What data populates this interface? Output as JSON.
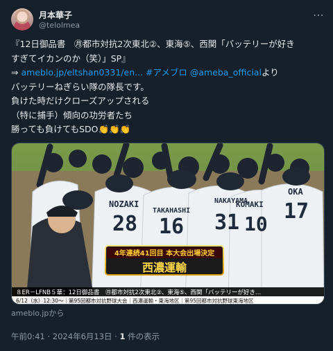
{
  "author": {
    "name": "月本華子",
    "handle": "@telolmea"
  },
  "tweet": {
    "line1": "『12日御品書　㊊都市対抗2次東北②、東海⑤、西関「バッテリーが好き",
    "line2": "すぎてイカンのか（笑）」SP』",
    "line3_prefix": "⇒ ",
    "line3_link1": "ameblo.jp/eltshan0331/en...",
    "line3_link2": " #アメブロ @ameba_official",
    "line3_suffix": "より",
    "line4": "バッテリーねぎらい隊の隊長です。",
    "line5": "負けた時だけクローズアップされる",
    "line6": "（特に捕手）傾向の功労者たち",
    "line7_text": "勝っても負けてもSDO",
    "line7_emoji": "👏👏👏"
  },
  "media": {
    "banner_top": "4年連続41回目 本大会出場決定",
    "banner_team": "西濃運輸",
    "jerseys": [
      "NOZAKI",
      "28",
      "TAKAHASHI",
      "16",
      "NAKAYAMA",
      "31",
      "KOMAKI",
      "10",
      "OKA",
      "17"
    ],
    "ticker_top": "８ER－LFNB５華：12日御品書　㊊都市対抗2次東北②、東海⑤、西関「バッテリーが好き...",
    "ticker_bottom": "6/12（水）12:30～｜第95回都市対抗野球大会｜西濃運輸・東海地区｜第95回都市対抗野球東海地区"
  },
  "source_label": "ameblo.jpから",
  "meta": {
    "time": "午前0:41",
    "date": "2024年6月13日",
    "views_count": "1",
    "views_label": "件の表示"
  },
  "colors": {
    "background": "#15202b",
    "link": "#1d9bf0",
    "muted": "#8b98a5",
    "banner_gold": "#f0b400",
    "banner_red": "#e02020"
  }
}
